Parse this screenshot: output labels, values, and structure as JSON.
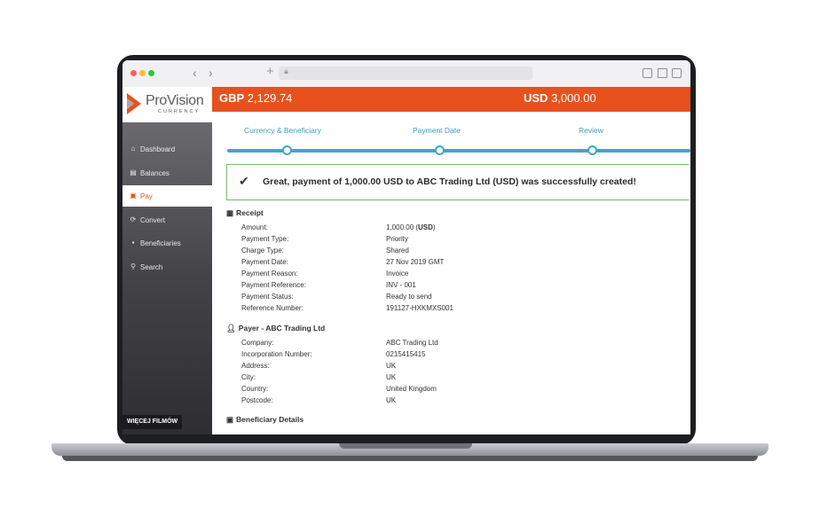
{
  "browser": {
    "traffic_colors": [
      "#ff5f57",
      "#febc2e",
      "#28c840"
    ],
    "back_icon": "chevron-left-icon",
    "forward_icon": "chevron-right-icon",
    "new_tab_icon": "plus-icon",
    "lock_icon": "lock-icon",
    "toolbar_icons": [
      "sidebar-icon",
      "share-icon",
      "tabs-icon"
    ]
  },
  "brand": {
    "name": "ProVision",
    "tagline": "CURRENCY",
    "colors": {
      "primary": "#e8511d",
      "accent": "#3fa7c9",
      "success_border": "#78b873"
    }
  },
  "sidebar": {
    "items": [
      {
        "icon": "home-icon",
        "label": "Dashboard",
        "active": false
      },
      {
        "icon": "balances-icon",
        "label": "Balances",
        "active": false
      },
      {
        "icon": "pay-icon",
        "label": "Pay",
        "active": true
      },
      {
        "icon": "convert-icon",
        "label": "Convert",
        "active": false
      },
      {
        "icon": "beneficiaries-icon",
        "label": "Beneficiaries",
        "active": false
      },
      {
        "icon": "search-icon",
        "label": "Search",
        "active": false
      }
    ],
    "more_films_label": "WIĘCEJ FILMÓW"
  },
  "balances": {
    "gbp": {
      "currency": "GBP",
      "amount": "2,129.74"
    },
    "usd": {
      "currency": "USD",
      "amount": "3,000.00"
    }
  },
  "steps": [
    {
      "label": "Currency & Beneficiary"
    },
    {
      "label": "Payment Date"
    },
    {
      "label": "Review"
    }
  ],
  "alert": {
    "icon": "checkmark-icon",
    "message": "Great, payment of 1,000.00 USD to ABC Trading Ltd (USD) was successfully created!"
  },
  "receipt": {
    "title": "Receipt",
    "icon": "receipt-icon",
    "amount_label": "Amount:",
    "amount_value": "1,000.00",
    "amount_currency": "USD",
    "rows": [
      {
        "label": "Payment Type:",
        "value": "Priority"
      },
      {
        "label": "Charge Type:",
        "value": "Shared"
      },
      {
        "label": "Payment Date:",
        "value": "27 Nov 2019 GMT"
      },
      {
        "label": "Payment Reason:",
        "value": "Invoice"
      },
      {
        "label": "Payment Reference:",
        "value": "INV - 001"
      },
      {
        "label": "Payment Status:",
        "value": "Ready to send"
      },
      {
        "label": "Reference Number:",
        "value": "191127-HXKMXS001"
      }
    ]
  },
  "payer": {
    "title": "Payer - ABC Trading Ltd",
    "icon": "user-icon",
    "rows": [
      {
        "label": "Company:",
        "value": "ABC Trading Ltd"
      },
      {
        "label": "Incorporation Number:",
        "value": "0215415415"
      },
      {
        "label": "Address:",
        "value": "UK"
      },
      {
        "label": "City:",
        "value": "UK"
      },
      {
        "label": "Country:",
        "value": "United Kingdom"
      },
      {
        "label": "Postcode:",
        "value": "UK"
      }
    ]
  },
  "beneficiary": {
    "title": "Beneficiary Details",
    "icon": "id-card-icon"
  }
}
